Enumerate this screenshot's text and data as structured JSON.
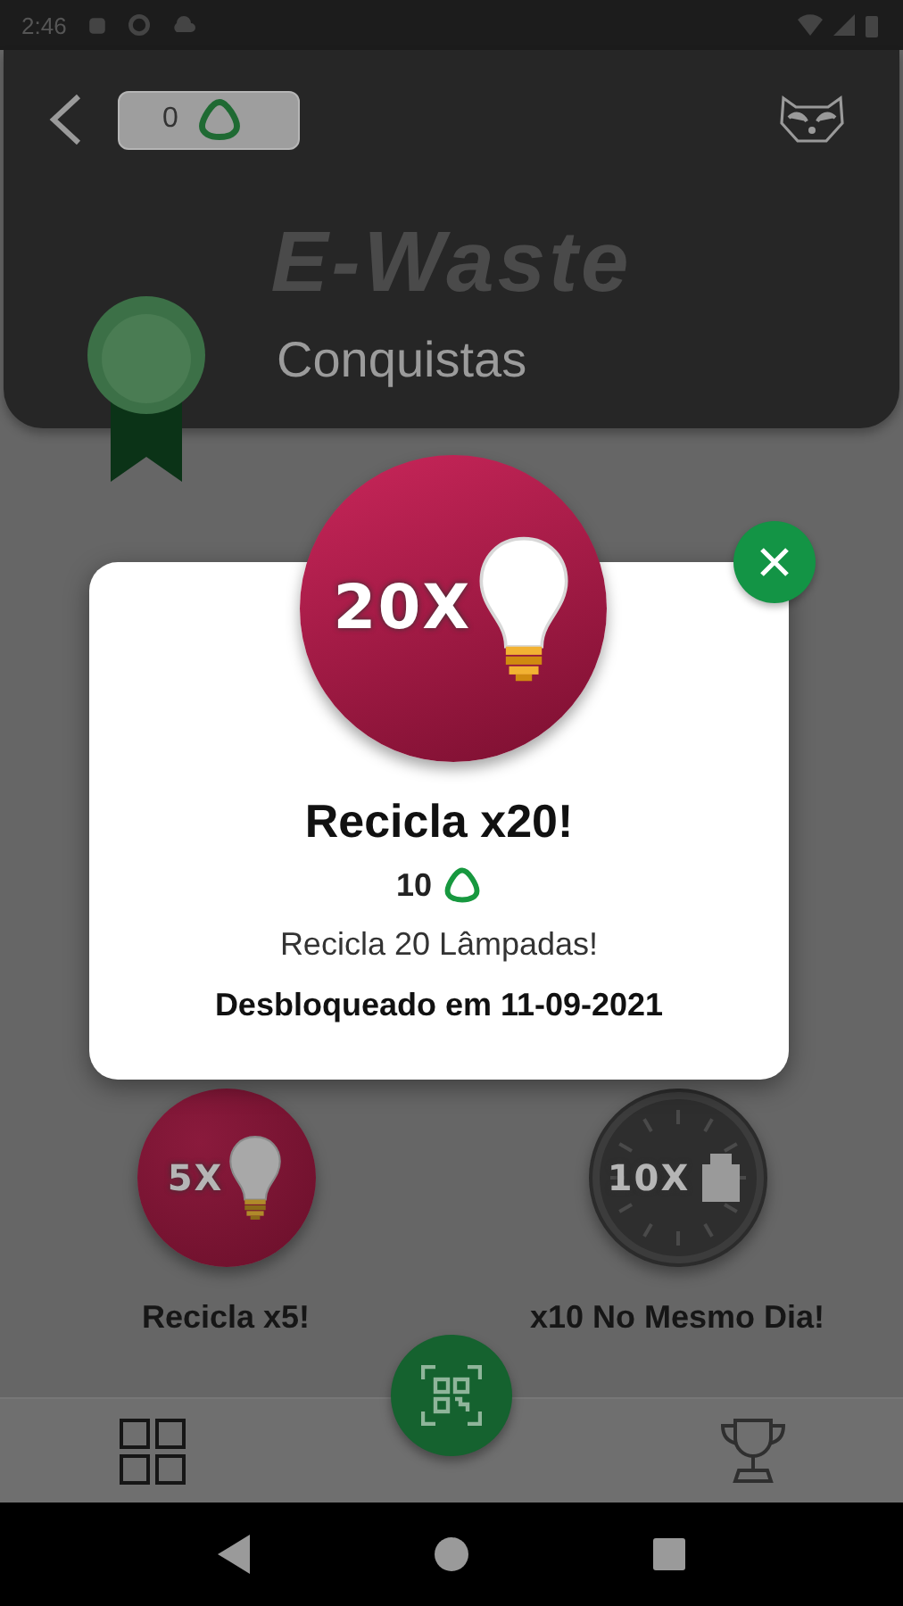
{
  "status_bar": {
    "time": "2:46"
  },
  "header": {
    "points": "0",
    "logo_text": "E-Waste",
    "title": "Conquistas"
  },
  "achievements": [
    {
      "kind": "bulb",
      "badge_text": "5X",
      "label": "Recicla x5!",
      "unlocked": true
    },
    {
      "kind": "clock",
      "badge_text": "10X",
      "label": "x10 No Mesmo Dia!",
      "unlocked": false
    }
  ],
  "dialog": {
    "kind": "bulb",
    "badge_text": "20X",
    "title": "Recicla x20!",
    "points": "10",
    "description": "Recicla 20 Lâmpadas!",
    "unlocked_text": "Desbloqueado em 11-09-2021"
  }
}
